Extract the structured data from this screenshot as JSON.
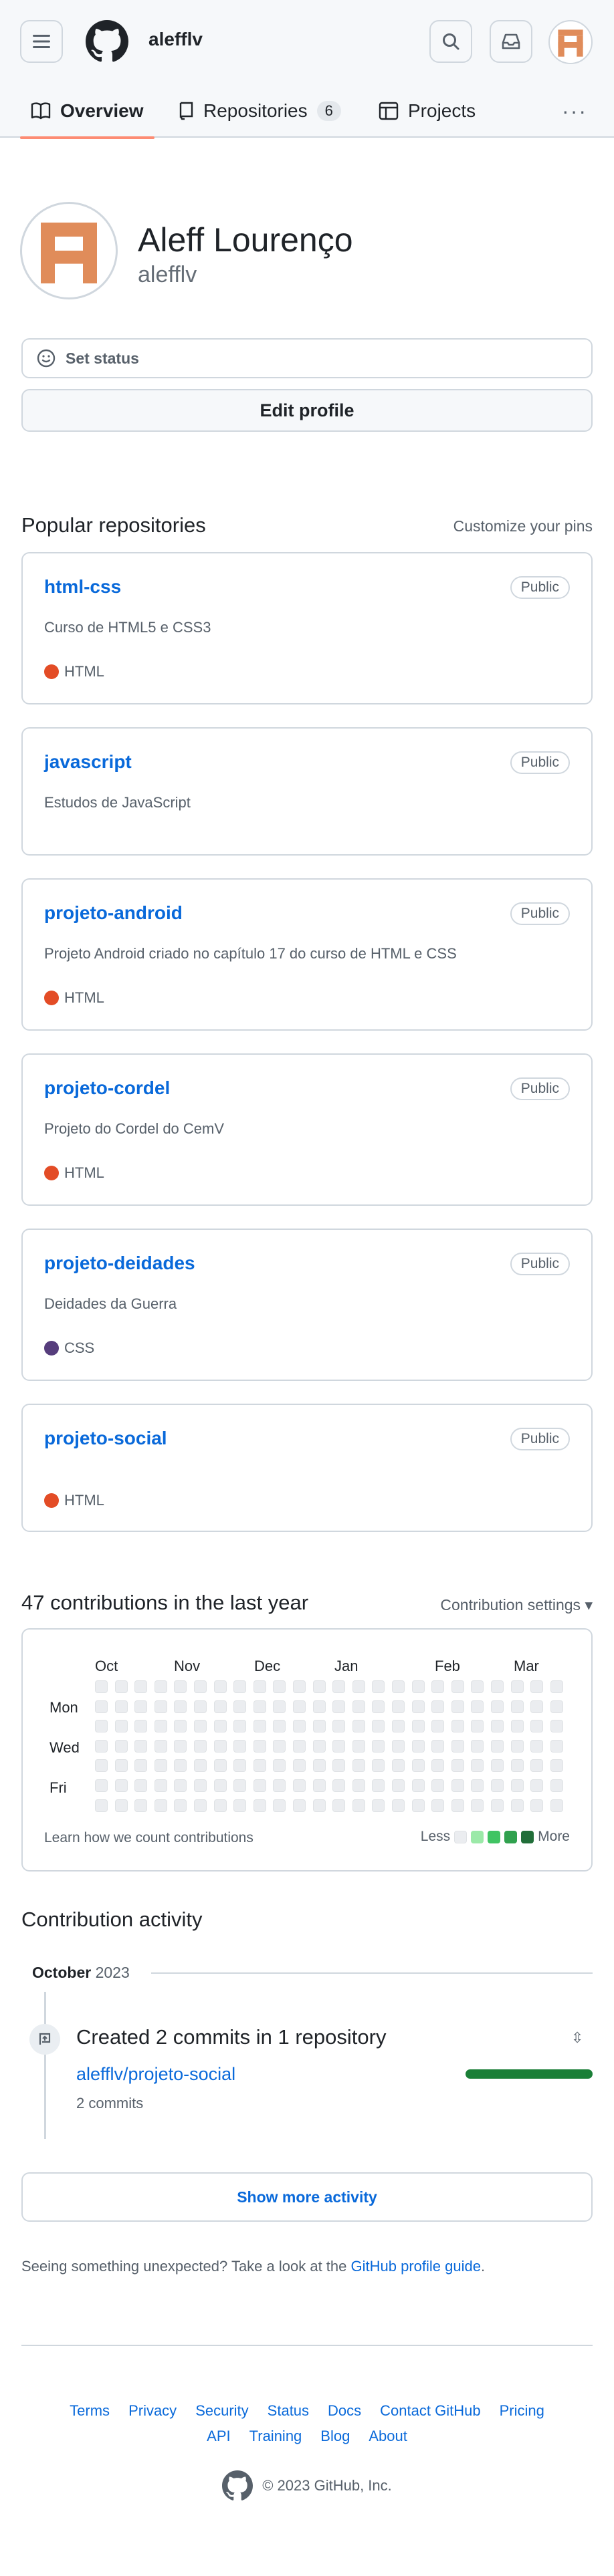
{
  "header": {
    "username": "alefflv"
  },
  "tabs": [
    {
      "label": "Overview"
    },
    {
      "label": "Repositories",
      "count": "6"
    },
    {
      "label": "Projects"
    }
  ],
  "profile": {
    "name": "Aleff Lourenço",
    "login": "alefflv",
    "set_status": "Set status",
    "edit_profile": "Edit profile"
  },
  "popular": {
    "title": "Popular repositories",
    "customize": "Customize your pins",
    "repos": [
      {
        "name": "html-css",
        "visibility": "Public",
        "description": "Curso de HTML5 e CSS3",
        "language": "HTML",
        "color": "#e34c26"
      },
      {
        "name": "javascript",
        "visibility": "Public",
        "description": "Estudos de JavaScript",
        "language": "",
        "color": ""
      },
      {
        "name": "projeto-android",
        "visibility": "Public",
        "description": "Projeto Android criado no capítulo 17 do curso de HTML e CSS",
        "language": "HTML",
        "color": "#e34c26"
      },
      {
        "name": "projeto-cordel",
        "visibility": "Public",
        "description": "Projeto do Cordel do CemV",
        "language": "HTML",
        "color": "#e34c26"
      },
      {
        "name": "projeto-deidades",
        "visibility": "Public",
        "description": "Deidades da Guerra",
        "language": "CSS",
        "color": "#563d7c"
      },
      {
        "name": "projeto-social",
        "visibility": "Public",
        "description": "",
        "language": "HTML",
        "color": "#e34c26"
      }
    ]
  },
  "contributions": {
    "title": "47 contributions in the last year",
    "settings": "Contribution settings",
    "months": [
      "Oct",
      "Nov",
      "Dec",
      "Jan",
      "Feb",
      "Mar"
    ],
    "days": [
      "Mon",
      "Wed",
      "Fri"
    ],
    "learn": "Learn how we count contributions",
    "less": "Less",
    "more": "More",
    "legend_colors": [
      "#ebedf0",
      "#9be9a8",
      "#40c463",
      "#30a14e",
      "#216e39"
    ]
  },
  "activity": {
    "title": "Contribution activity",
    "month": "October",
    "year": "2023",
    "event_title": "Created 2 commits in 1 repository",
    "repo": "alefflv/projeto-social",
    "commits": "2 commits",
    "show_more": "Show more activity",
    "unexpected_text": "Seeing something unexpected? Take a look at the ",
    "guide_link": "GitHub profile guide",
    "unexpected_end": "."
  },
  "footer": {
    "row1": [
      "Terms",
      "Privacy",
      "Security",
      "Status",
      "Docs",
      "Contact GitHub",
      "Pricing"
    ],
    "row2": [
      "API",
      "Training",
      "Blog",
      "About"
    ],
    "copyright": "© 2023 GitHub, Inc."
  },
  "colors": {
    "accent": "#fd8c73",
    "link": "#0969da",
    "green": "#1a7f37",
    "avatar": "#e08c5a"
  }
}
